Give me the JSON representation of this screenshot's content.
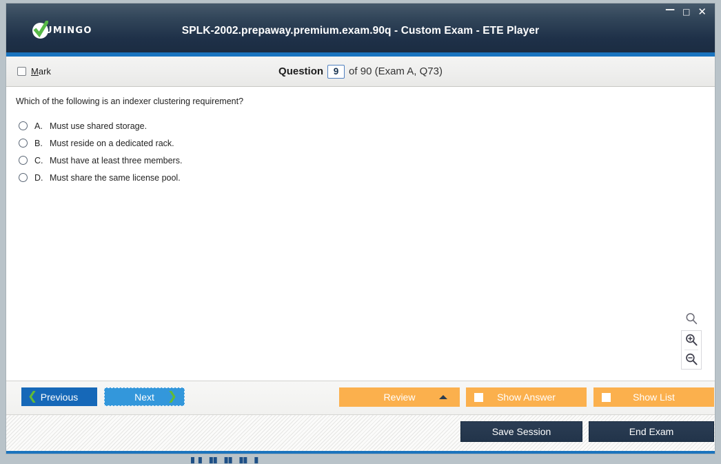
{
  "window": {
    "title": "SPLK-2002.prepaway.premium.exam.90q - Custom Exam - ETE Player",
    "logo_text": "UMINGO",
    "controls": {
      "minimize": "—",
      "maximize": "□",
      "close": "✕"
    },
    "accent_color": "#1b74bd",
    "titlebar_color": "#1e3048"
  },
  "question_header": {
    "mark_label_prefix": "M",
    "mark_label_rest": "ark",
    "question_label": "Question",
    "question_number": "9",
    "rest_text": "of 90 (Exam A, Q73)"
  },
  "question": {
    "text": "Which of the following is an indexer clustering requirement?",
    "options": [
      {
        "letter": "A.",
        "text": "Must use shared storage."
      },
      {
        "letter": "B.",
        "text": "Must reside on a dedicated rack."
      },
      {
        "letter": "C.",
        "text": "Must have at least three members."
      },
      {
        "letter": "D.",
        "text": "Must share the same license pool."
      }
    ]
  },
  "zoom_tools": {
    "reset_icon": "magnifier-icon",
    "zoom_in_icon": "zoom-in-icon",
    "zoom_out_icon": "zoom-out-icon"
  },
  "toolbar": {
    "previous_label": "Previous",
    "next_label": "Next",
    "review_label": "Review",
    "show_answer_label": "Show Answer",
    "show_list_label": "Show List",
    "prev_chevron": "❮",
    "next_chevron": "❯",
    "primary_button_color": "#1668b8",
    "focus_button_color": "#3397db",
    "orange_button_color": "#fbb04d"
  },
  "footer": {
    "save_session_label": "Save Session",
    "end_exam_label": "End Exam",
    "dark_button_color": "#22344a",
    "clipped_text": "▌▌▐▌▐▌▐▌▐"
  }
}
